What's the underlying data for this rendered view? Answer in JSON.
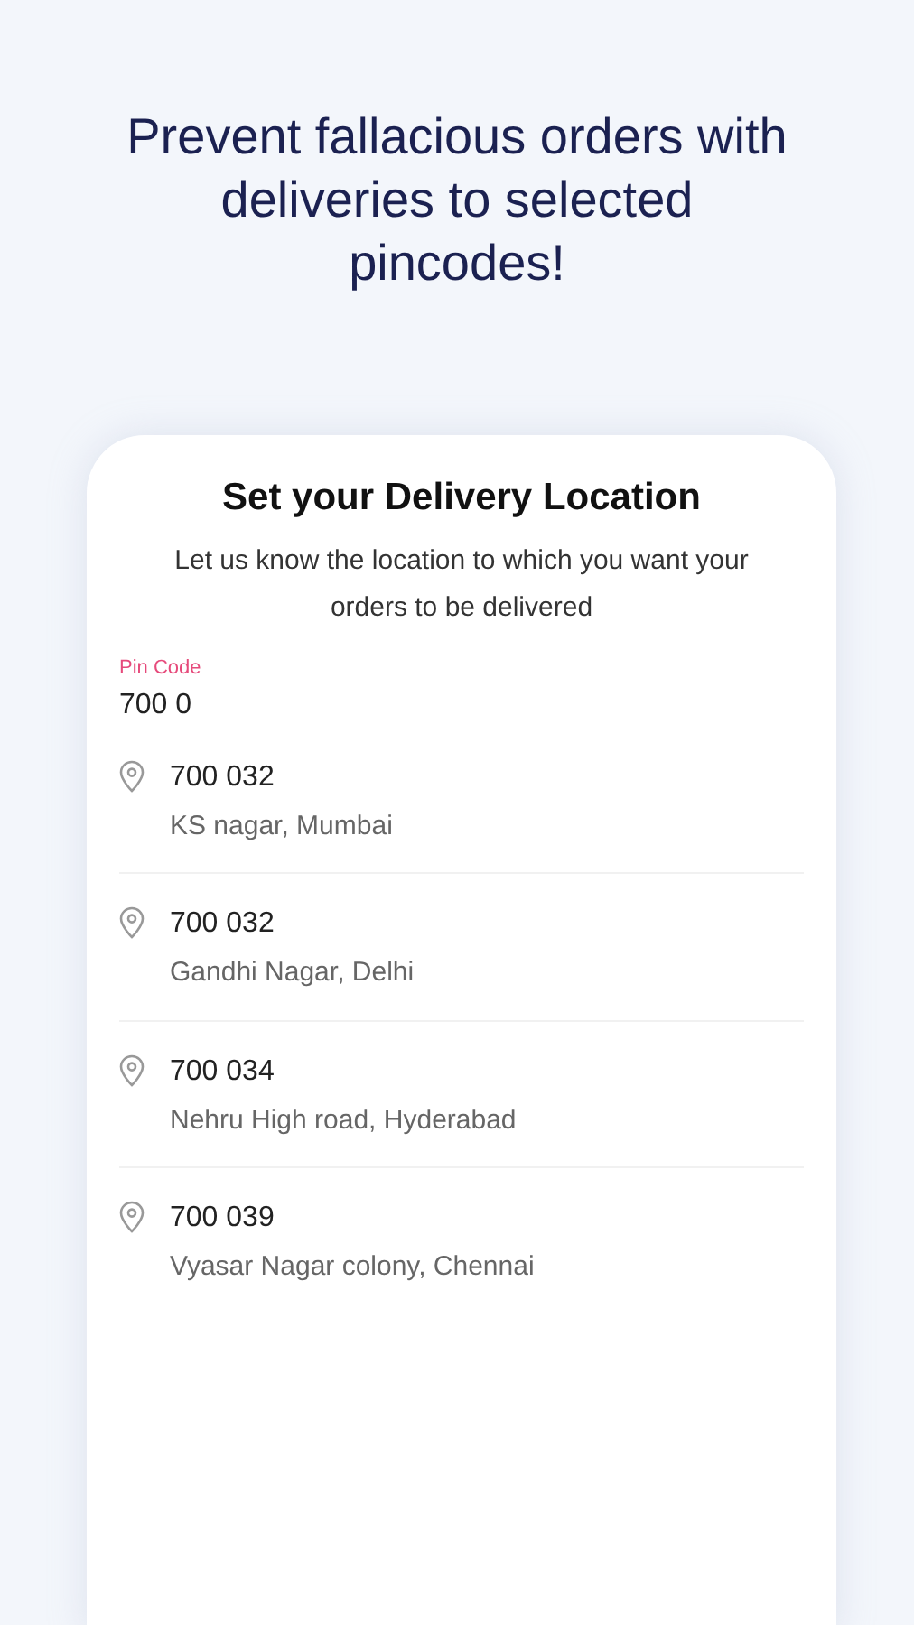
{
  "headline": "Prevent fallacious orders with deliveries to selected pincodes!",
  "card": {
    "title": "Set your Delivery Location",
    "subtitle": "Let us know the location to which you want your orders to be delivered",
    "pin_field": {
      "label": "Pin Code",
      "value": "700 0"
    },
    "suggestions": [
      {
        "pincode": "700 032",
        "area": "KS nagar, Mumbai"
      },
      {
        "pincode": "700 032",
        "area": "Gandhi Nagar, Delhi"
      },
      {
        "pincode": "700 034",
        "area": "Nehru High road, Hyderabad"
      },
      {
        "pincode": "700 039",
        "area": "Vyasar Nagar colony, Chennai"
      }
    ]
  }
}
